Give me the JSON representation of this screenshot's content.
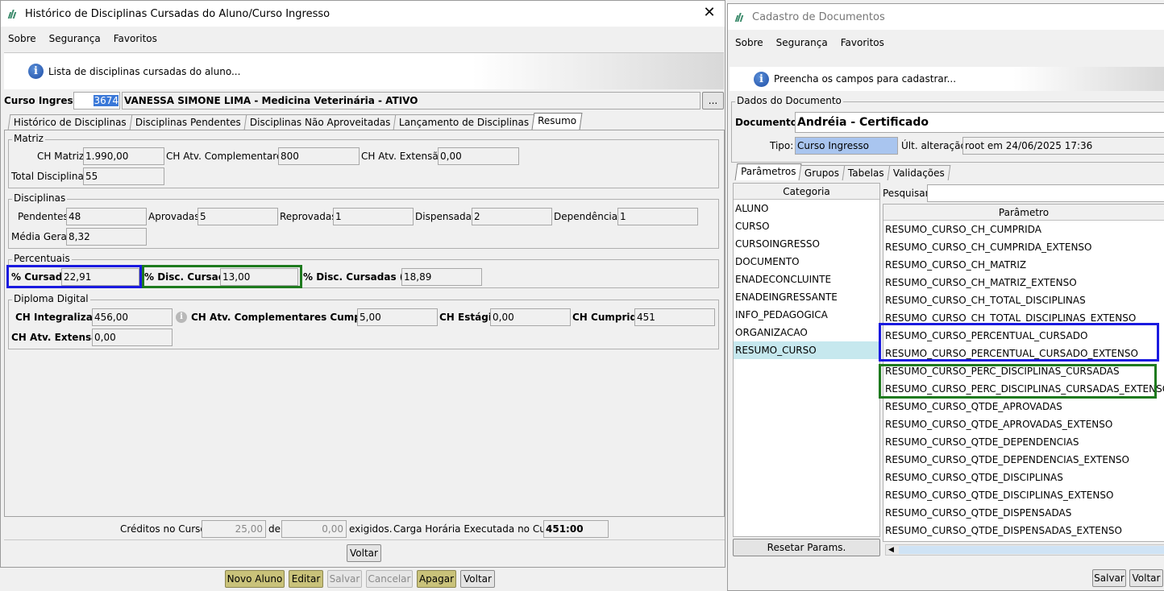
{
  "left_window": {
    "title": "Histórico de Disciplinas Cursadas do Aluno/Curso Ingresso",
    "menu": [
      "Sobre",
      "Segurança",
      "Favoritos"
    ],
    "info": "Lista de disciplinas cursadas do aluno...",
    "curso_ingresso_label": "Curso Ingresso:",
    "curso_ingresso_code": "3674",
    "curso_ingresso_name": "VANESSA SIMONE LIMA - Medicina Veterinária - ATIVO",
    "ellipsis": "...",
    "tabs": [
      "Histórico de Disciplinas",
      "Disciplinas Pendentes",
      "Disciplinas Não Aproveitadas",
      "Lançamento de Disciplinas",
      "Resumo"
    ],
    "matriz": {
      "title": "Matriz",
      "ch_matriz_label": "CH Matriz:",
      "ch_matriz": "1.990,00",
      "ch_comp_label": "CH Atv. Complementares:",
      "ch_comp": "800",
      "ch_ext_label": "CH Atv. Extensão:",
      "ch_ext": "0,00",
      "total_label": "Total Disciplinas:",
      "total": "55"
    },
    "disciplinas": {
      "title": "Disciplinas",
      "pendentes_label": "Pendentes:",
      "pendentes": "48",
      "aprovadas_label": "Aprovadas:",
      "aprovadas": "5",
      "reprovadas_label": "Reprovadas:",
      "reprovadas": "1",
      "dispensadas_label": "Dispensadas:",
      "dispensadas": "2",
      "dependencias_label": "Dependências:",
      "dependencias": "1",
      "media_label": "Média Geral:",
      "media": "8,32"
    },
    "percentuais": {
      "title": "Percentuais",
      "cursado_label": "% Cursado:",
      "cursado": "22,91",
      "disc_label": "% Disc. Cursadas:",
      "disc": "13,00",
      "disc_hr_label": "% Disc. Cursadas (HR):",
      "disc_hr": "18,89"
    },
    "diploma": {
      "title": "Diploma Digital",
      "ch_int_label": "CH Integralizada:",
      "ch_int": "456,00",
      "ch_comp_cump_label": "CH Atv. Complementares Cumpridas:",
      "ch_comp_cump": "5,00",
      "ch_estagio_label": "CH Estágio:",
      "ch_estagio": "0,00",
      "ch_cumprida_label": "CH Cumprida:",
      "ch_cumprida": "451",
      "ch_ext_label": "CH Atv. Extensão:",
      "ch_ext": "0,00"
    },
    "footer": {
      "creditos_label": "Créditos no Curso:",
      "creditos": "25,00",
      "de_label": "de",
      "exigidos": "0,00",
      "exigidos_label": "exigidos.",
      "carga_label": "Carga Horária Executada no Curso:",
      "carga": "451:00"
    },
    "voltar": "Voltar"
  },
  "bottom_toolbar": [
    "Novo Aluno",
    "Editar",
    "Salvar",
    "Cancelar",
    "Apagar",
    "Voltar"
  ],
  "right_window": {
    "title": "Cadastro de Documentos",
    "menu": [
      "Sobre",
      "Segurança",
      "Favoritos"
    ],
    "info": "Preencha os campos para cadastrar...",
    "group_title": "Dados do Documento",
    "documento_label": "Documento:",
    "documento": "Andréia - Certificado",
    "tipo_label": "Tipo:",
    "tipo": "Curso Ingresso",
    "ult_label": "Últ. alteração:",
    "ult": "root em 24/06/2025 17:36",
    "tabs": [
      "Parâmetros",
      "Grupos",
      "Tabelas",
      "Validações"
    ],
    "categoria_header": "Categoria",
    "categorias": [
      "ALUNO",
      "CURSO",
      "CURSOINGRESSO",
      "DOCUMENTO",
      "ENADECONCLUINTE",
      "ENADEINGRESSANTE",
      "INFO_PEDAGOGICA",
      "ORGANIZACAO",
      "RESUMO_CURSO"
    ],
    "pesquisar_label": "Pesquisar:",
    "parametro_header": "Parâmetro",
    "parametros": [
      "RESUMO_CURSO_CH_CUMPRIDA",
      "RESUMO_CURSO_CH_CUMPRIDA_EXTENSO",
      "RESUMO_CURSO_CH_MATRIZ",
      "RESUMO_CURSO_CH_MATRIZ_EXTENSO",
      "RESUMO_CURSO_CH_TOTAL_DISCIPLINAS",
      "RESUMO_CURSO_CH_TOTAL_DISCIPLINAS_EXTENSO",
      "RESUMO_CURSO_PERCENTUAL_CURSADO",
      "RESUMO_CURSO_PERCENTUAL_CURSADO_EXTENSO",
      "RESUMO_CURSO_PERC_DISCIPLINAS_CURSADAS",
      "RESUMO_CURSO_PERC_DISCIPLINAS_CURSADAS_EXTENSO",
      "RESUMO_CURSO_QTDE_APROVADAS",
      "RESUMO_CURSO_QTDE_APROVADAS_EXTENSO",
      "RESUMO_CURSO_QTDE_DEPENDENCIAS",
      "RESUMO_CURSO_QTDE_DEPENDENCIAS_EXTENSO",
      "RESUMO_CURSO_QTDE_DISCIPLINAS",
      "RESUMO_CURSO_QTDE_DISCIPLINAS_EXTENSO",
      "RESUMO_CURSO_QTDE_DISPENSADAS",
      "RESUMO_CURSO_QTDE_DISPENSADAS_EXTENSO"
    ],
    "resetar": "Resetar Params.",
    "salvar": "Salvar",
    "voltar": "Voltar"
  },
  "colors": {
    "highlight_blue": "#1a1ae0",
    "highlight_green": "#1e7a1e",
    "toolbar_gold": "#c9c27a",
    "selected_row": "#c6e8ee"
  }
}
